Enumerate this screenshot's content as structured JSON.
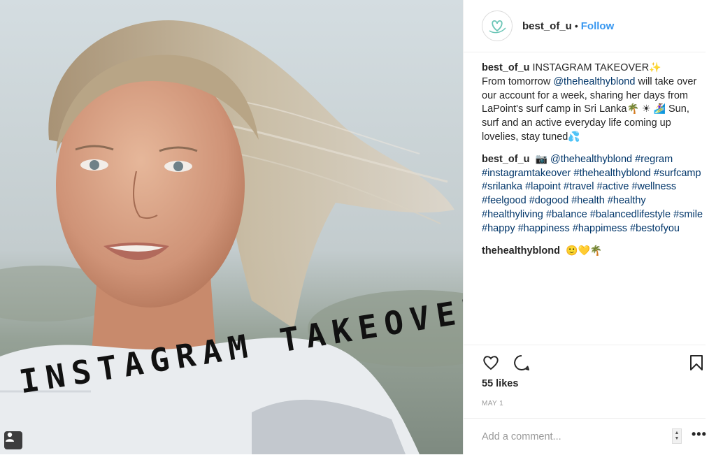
{
  "photo": {
    "overlay_text": "INSTAGRAM TAKEOVER"
  },
  "header": {
    "username": "best_of_u",
    "separator": "•",
    "follow_label": "Follow"
  },
  "caption": {
    "username": "best_of_u",
    "text_1": "INSTAGRAM TAKEOVER",
    "emoji_1": "✨",
    "text_2": "From tomorrow",
    "mention": "@thehealthyblond",
    "text_3": "will take over our account for a week, sharing her days from LaPoint's surf camp in Sri Lanka",
    "emoji_2": "🌴",
    "emoji_3": "☀",
    "emoji_4": "🏄‍♀",
    "text_4": "Sun, surf and an active everyday life coming up lovelies, stay tuned",
    "emoji_5": "💦"
  },
  "comment_2": {
    "username": "best_of_u",
    "emoji": "📷",
    "mention": "@thehealthyblond",
    "hashtags": [
      "#regram",
      "#instagramtakeover",
      "#thehealthyblond",
      "#surfcamp",
      "#srilanka",
      "#lapoint",
      "#travel",
      "#active",
      "#wellness",
      "#feelgood",
      "#dogood",
      "#health",
      "#healthy",
      "#healthyliving",
      "#balance",
      "#balancedlifestyle",
      "#smile",
      "#happy",
      "#happiness",
      "#happimess",
      "#bestofyou"
    ]
  },
  "comment_3": {
    "username": "thehealthyblond",
    "emojis": "🙂💛🌴"
  },
  "actions": {
    "like_icon": "heart-icon",
    "comment_icon": "speech-bubble-icon",
    "save_icon": "bookmark-icon"
  },
  "likes": "55 likes",
  "date": "MAY 1",
  "add_comment": {
    "placeholder": "Add a comment...",
    "more_label": "•••"
  },
  "colors": {
    "link": "#003569",
    "follow": "#3897f0",
    "avatar_heart": "#6cc6b7"
  }
}
